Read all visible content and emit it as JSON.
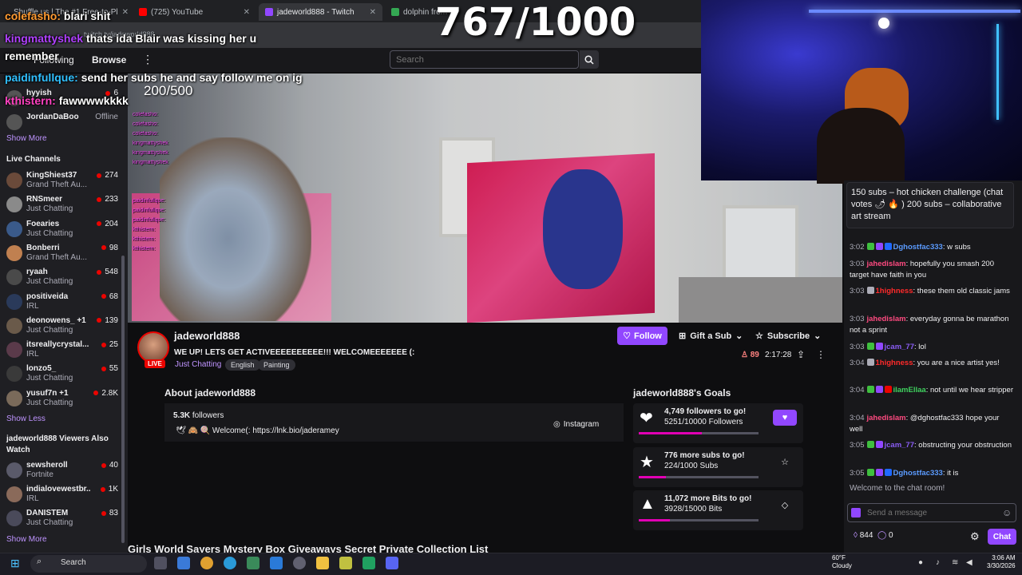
{
  "browser": {
    "tabs": [
      {
        "label": "Shuffle.us | The #1 Free-to-Pl",
        "active": false
      },
      {
        "label": "(725) YouTube",
        "active": false
      },
      {
        "label": "jadeworld888 - Twitch",
        "active": true
      },
      {
        "label": "dolphin from sp",
        "active": false
      }
    ],
    "address": "twitch.tv/jadeworld888"
  },
  "overlay": {
    "counter": "767/1000",
    "sub_counter": "200/500",
    "chat_lines": [
      {
        "user": "colefasho:",
        "text": "blari shit"
      },
      {
        "user": "kingmattyshek",
        "text": "thats ida Blair was kissing her u"
      },
      {
        "user": "",
        "text": "remember"
      },
      {
        "user": "paidinfullque:",
        "text": "send her subs he and say follow me on ig"
      },
      {
        "user": "kthistern:",
        "text": "fawwwwkkkk"
      }
    ]
  },
  "nav": {
    "following": "Following",
    "browse": "Browse",
    "more": "⋮",
    "search_placeholder": "Search"
  },
  "sidebar": {
    "followed": [
      {
        "name": "hyyish",
        "viewers": "6"
      },
      {
        "name": "JordanDaBoo",
        "status": "Offline"
      }
    ],
    "show_more": "Show More",
    "live_header": "Live Channels",
    "live": [
      {
        "name": "KingShiest37",
        "game": "Grand Theft Au...",
        "viewers": "274",
        "color": "#6a4a3a"
      },
      {
        "name": "RNSmeer",
        "game": "Just Chatting",
        "viewers": "233",
        "color": "#8a8a8a"
      },
      {
        "name": "Foearies",
        "game": "Just Chatting",
        "viewers": "204",
        "color": "#3a5a8a"
      },
      {
        "name": "Bonberri",
        "game": "Grand Theft Au...",
        "viewers": "98",
        "color": "#c08050"
      },
      {
        "name": "ryaah",
        "game": "Just Chatting",
        "viewers": "548",
        "color": "#4a4a4a"
      },
      {
        "name": "positiveida",
        "game": "IRL",
        "viewers": "68",
        "color": "#2a3a5a"
      },
      {
        "name": "deonowens_ +1",
        "game": "Just Chatting",
        "viewers": "139",
        "color": "#6a5a4a"
      },
      {
        "name": "itsreallycrystal...",
        "game": "IRL",
        "viewers": "25",
        "color": "#5a3a4a"
      },
      {
        "name": "lonzo5_",
        "game": "Just Chatting",
        "viewers": "55",
        "color": "#3a3a3a"
      },
      {
        "name": "yusuf7n +1",
        "game": "Just Chatting",
        "viewers": "2.8K",
        "color": "#7a6a5a"
      }
    ],
    "show_less": "Show Less",
    "also_watch_header": "jadeworld888 Viewers Also Watch",
    "also_watch": [
      {
        "name": "sewsheroll",
        "game": "Fortnite",
        "viewers": "40",
        "color": "#5a5a6a"
      },
      {
        "name": "indialovewestbr...",
        "game": "IRL",
        "viewers": "1K",
        "color": "#8a6a5a"
      },
      {
        "name": "DANISTEM",
        "game": "Just Chatting",
        "viewers": "83",
        "color": "#4a4a5a"
      }
    ],
    "show_more_2": "Show More"
  },
  "channel": {
    "name": "jadeworld888",
    "live": "LIVE",
    "title": "WE UP! LETS GET ACTIVEEEEEEEEEE!!! WELCOMEEEEEEE (:",
    "category": "Just Chatting",
    "tags": [
      "English",
      "Painting"
    ],
    "follow": "Follow",
    "gift": "Gift a Sub",
    "subscribe": "Subscribe",
    "viewers": "89",
    "uptime": "2:17:28"
  },
  "about": {
    "title": "About jadeworld888",
    "followers_count": "5.3K",
    "followers_label": "followers",
    "bio": "🕊 🙈 🍭 Welcome(: https://lnk.bio/jaderamey",
    "instagram": "Instagram"
  },
  "goals": {
    "title": "jadeworld888's Goals",
    "items": [
      {
        "headline": "4,749 followers to go!",
        "sub": "5251/10000 Followers",
        "progress": 0.525,
        "icon": "❤",
        "button": "♥"
      },
      {
        "headline": "776 more subs to go!",
        "sub": "224/1000 Subs",
        "progress": 0.224,
        "icon": "★",
        "button": "☆"
      },
      {
        "headline": "11,072 more Bits to go!",
        "sub": "3928/15000 Bits",
        "progress": 0.262,
        "icon": "▲",
        "button": "◇"
      }
    ]
  },
  "bottom_strip": "Girls World Sayers   Mystery Box Giveaways   Secret Private Collection List",
  "chat": {
    "goal_banner": "150 subs – hot chicken challenge (chat votes 🌶 🔥 ) 200 subs – collaborative art stream",
    "messages": [
      {
        "time": "3:02",
        "user": "Dghostfac333",
        "text": ": w subs",
        "color": "#5b9bff",
        "badges": [
          "#3fbf3f",
          "#9147ff",
          "#1f69ff"
        ]
      },
      {
        "time": "3:03",
        "user": "jahedislam",
        "text": ": hopefully you smash 200 target have faith in you",
        "color": "#ff4a80",
        "badges": []
      },
      {
        "time": "3:03",
        "user": "1highness",
        "text": ": these them old classic jams",
        "color": "#ff2a2a",
        "badges": [
          "#adadb8"
        ]
      },
      {
        "time": "3:03",
        "user": "jahedislam",
        "text": ": everyday gonna be marathon not a sprint",
        "color": "#ff4a80",
        "badges": []
      },
      {
        "time": "3:03",
        "user": "jcam_77",
        "text": ": lol",
        "color": "#8a5cf5",
        "badges": [
          "#3fbf3f",
          "#9147ff"
        ]
      },
      {
        "time": "3:04",
        "user": "1highness",
        "text": ": you are a nice artist yes!",
        "color": "#ff2a2a",
        "badges": [
          "#adadb8"
        ]
      },
      {
        "time": "3:04",
        "user": "iIamEllaa",
        "text": ": not until we hear stripper",
        "color": "#3fd25f",
        "badges": [
          "#3fbf3f",
          "#9147ff",
          "#eb0400"
        ]
      },
      {
        "time": "3:04",
        "user": "jahedislam",
        "text": ": @dghostfac333 hope your well",
        "color": "#ff4a80",
        "badges": []
      },
      {
        "time": "3:05",
        "user": "jcam_77",
        "text": ": obstructing your obstruction",
        "color": "#8a5cf5",
        "badges": [
          "#3fbf3f",
          "#9147ff"
        ]
      },
      {
        "time": "3:05",
        "user": "Dghostfac333",
        "text": ": it is",
        "color": "#5b9bff",
        "badges": [
          "#3fbf3f",
          "#9147ff",
          "#1f69ff"
        ]
      }
    ],
    "welcome": "Welcome to the chat room!",
    "input_placeholder": "Send a message",
    "bits": "844",
    "points": "0",
    "chat_button": "Chat"
  },
  "taskbar": {
    "search": "Search",
    "weather_temp": "60°F",
    "weather_desc": "Cloudy",
    "time": "3:06 AM",
    "date": "3/30/2026"
  }
}
